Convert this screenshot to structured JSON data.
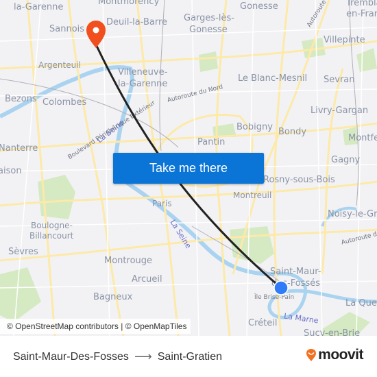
{
  "map": {
    "cta_label": "Take me there",
    "attribution": "© OpenStreetMap contributors | © OpenMapTiles",
    "colors": {
      "land": "#f2f2f4",
      "road": "#fde9a8",
      "park": "#cfe8b8",
      "water": "#aad3f0",
      "route": "#222222",
      "origin_marker": "#2f7cf6",
      "destination_marker": "#f1501e",
      "cta_background": "#0a75d6"
    },
    "places": [
      {
        "name": "la-Garenne"
      },
      {
        "name": "Montmorency"
      },
      {
        "name": "Gonesse"
      },
      {
        "name": "Tremblay-"
      },
      {
        "name": "en-France"
      },
      {
        "name": "Sannois"
      },
      {
        "name": "Deuil-la-Barre"
      },
      {
        "name": "Garges-lès-"
      },
      {
        "name": "Gonesse"
      },
      {
        "name": "Villepinte"
      },
      {
        "name": "Argenteuil"
      },
      {
        "name": "Villeneuve-"
      },
      {
        "name": "la-Garenne"
      },
      {
        "name": "Le Blanc-Mesnil"
      },
      {
        "name": "Sevran"
      },
      {
        "name": "Bezons"
      },
      {
        "name": "Colombes"
      },
      {
        "name": "Livry-Gargan"
      },
      {
        "name": "Bobigny"
      },
      {
        "name": "Bondy"
      },
      {
        "name": "Montfermeil"
      },
      {
        "name": "Nanterre"
      },
      {
        "name": "Pantin"
      },
      {
        "name": "Gagny"
      },
      {
        "name": "Rueil-Malmaison"
      },
      {
        "name": "Rosny-sous-Bois"
      },
      {
        "name": "Montreuil"
      },
      {
        "name": "Paris"
      },
      {
        "name": "Noisy-le-Grand"
      },
      {
        "name": "Boulogne-"
      },
      {
        "name": "Billancourt"
      },
      {
        "name": "Sèvres"
      },
      {
        "name": "Montrouge"
      },
      {
        "name": "Saint-Maur-"
      },
      {
        "name": "des-Fossés"
      },
      {
        "name": "Arcueil"
      },
      {
        "name": "Île Brise-Pain"
      },
      {
        "name": "La Queue-en-Brie"
      },
      {
        "name": "Bagneux"
      },
      {
        "name": "Créteil"
      },
      {
        "name": "Sucy-en-Brie"
      }
    ],
    "water_labels": [
      "La Seine",
      "La Seine",
      "La Marne"
    ],
    "road_labels": [
      "Autoroute du Nord",
      "Autoroute",
      "Boulevard Périphérique Extérieur",
      "Autoroute de l'Est"
    ]
  },
  "footer": {
    "origin": "Saint-Maur-Des-Fosses",
    "arrow": "⟶",
    "destination": "Saint-Gratien",
    "brand": "moovit"
  }
}
